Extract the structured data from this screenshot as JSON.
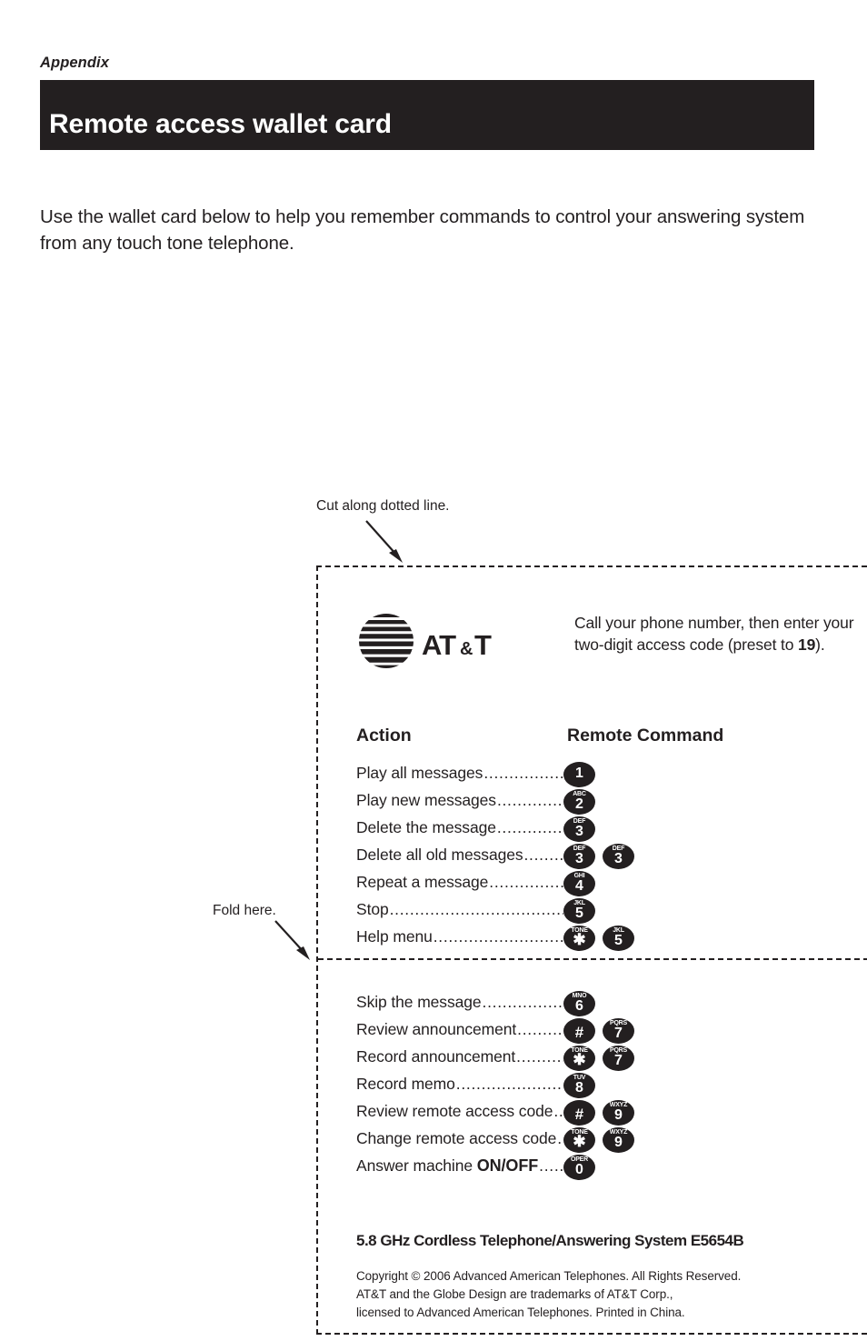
{
  "page": {
    "section_label": "Appendix",
    "title": "Remote access wallet card",
    "intro": "Use the wallet card below to help you remember commands to control your answering system from any touch tone telephone.",
    "title_bar_color": "#231f20"
  },
  "annotations": {
    "cut_note": "Cut along dotted line.",
    "fold_note": "Fold here."
  },
  "card": {
    "brand": "AT&T",
    "logo_icon": "att-globe-logo",
    "call_instruction_prefix": "Call your phone number, then enter your two-digit access code (preset to ",
    "access_code": "19",
    "call_instruction_suffix": ").",
    "headings": {
      "action": "Action",
      "command": "Remote Command"
    },
    "rows_top": [
      {
        "action": "Play all messages",
        "keys": [
          {
            "sub": "",
            "digit": "1"
          }
        ]
      },
      {
        "action": "Play new messages",
        "keys": [
          {
            "sub": "ABC",
            "digit": "2"
          }
        ]
      },
      {
        "action": "Delete the message",
        "keys": [
          {
            "sub": "DEF",
            "digit": "3"
          }
        ]
      },
      {
        "action": "Delete all old messages",
        "keys": [
          {
            "sub": "DEF",
            "digit": "3"
          },
          {
            "sub": "DEF",
            "digit": "3"
          }
        ]
      },
      {
        "action": "Repeat a message",
        "keys": [
          {
            "sub": "GHI",
            "digit": "4"
          }
        ]
      },
      {
        "action": "Stop",
        "keys": [
          {
            "sub": "JKL",
            "digit": "5"
          }
        ]
      },
      {
        "action": "Help menu",
        "keys": [
          {
            "sub": "TONE",
            "digit": "✱"
          },
          {
            "sub": "JKL",
            "digit": "5"
          }
        ]
      }
    ],
    "rows_bottom": [
      {
        "action": "Skip the message",
        "keys": [
          {
            "sub": "MNO",
            "digit": "6"
          }
        ]
      },
      {
        "action": "Review announcement",
        "keys": [
          {
            "sub": "",
            "digit": "#"
          },
          {
            "sub": "PQRS",
            "digit": "7"
          }
        ]
      },
      {
        "action": "Record announcement",
        "keys": [
          {
            "sub": "TONE",
            "digit": "✱"
          },
          {
            "sub": "PQRS",
            "digit": "7"
          }
        ]
      },
      {
        "action": "Record memo",
        "keys": [
          {
            "sub": "TUV",
            "digit": "8"
          }
        ]
      },
      {
        "action": "Review remote access code",
        "keys": [
          {
            "sub": "",
            "digit": "#"
          },
          {
            "sub": "WXYZ",
            "digit": "9"
          }
        ]
      },
      {
        "action": "Change remote access code",
        "keys": [
          {
            "sub": "TONE",
            "digit": "✱"
          },
          {
            "sub": "WXYZ",
            "digit": "9"
          }
        ]
      },
      {
        "action": "Answer machine ",
        "action_bold": "ON/OFF",
        "keys": [
          {
            "sub": "OPER",
            "digit": "0"
          }
        ]
      }
    ],
    "product_line": "5.8 GHz Cordless Telephone/Answering System E5654B",
    "copyright": "Copyright © 2006 Advanced American Telephones. All Rights Reserved.\nAT&T and the Globe Design are trademarks of AT&T Corp.,\nlicensed to Advanced American Telephones. Printed in China."
  }
}
